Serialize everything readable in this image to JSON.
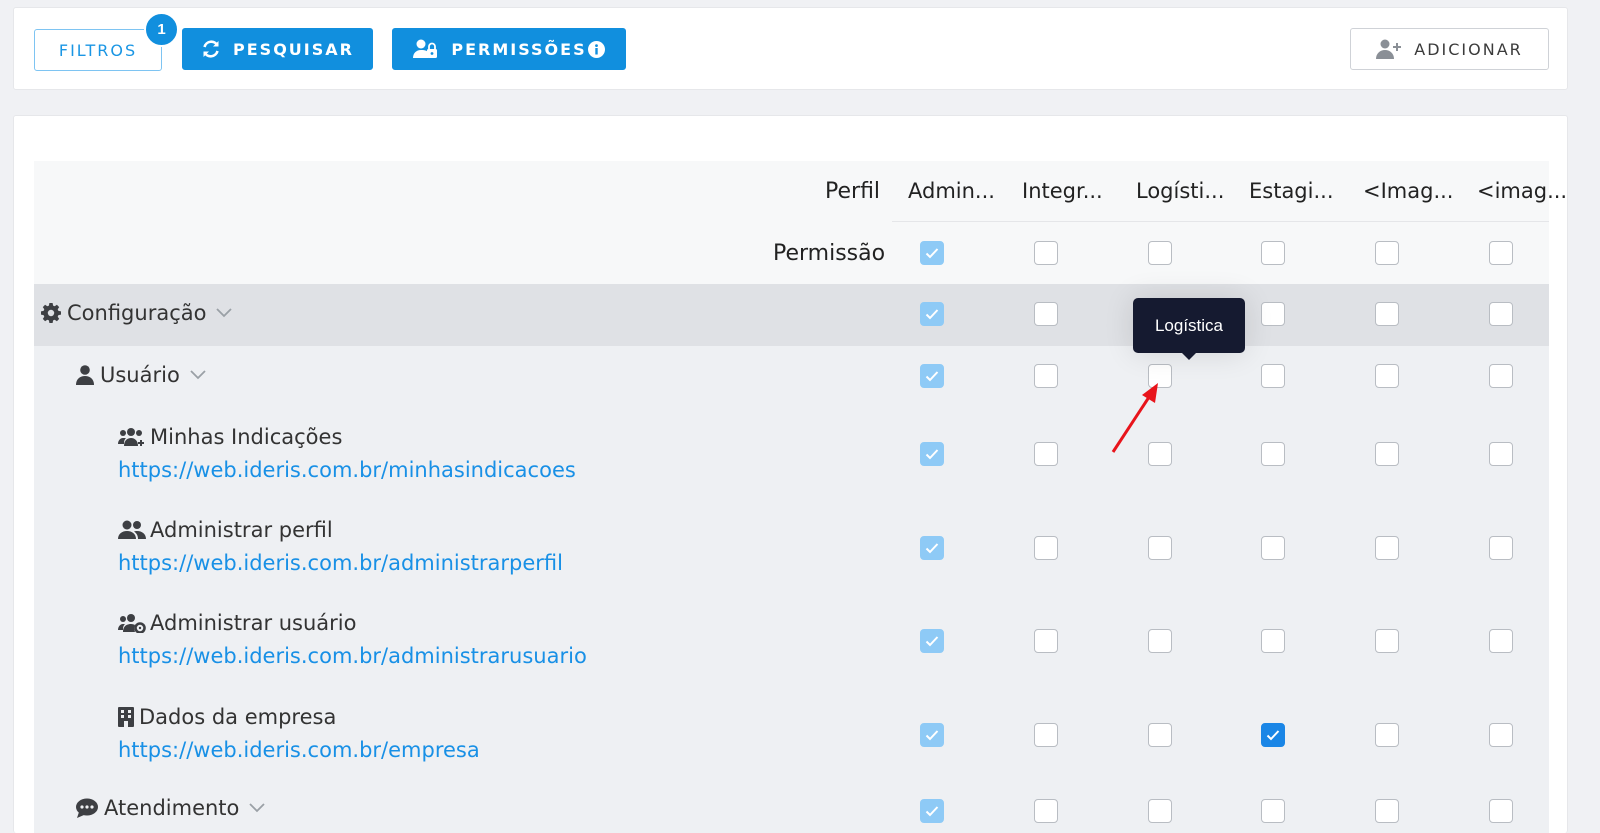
{
  "toolbar": {
    "filtros_label": "FILTROS",
    "filtros_badge": "1",
    "pesquisar_label": "PESQUISAR",
    "permissoes_label": "PERMISSÕES",
    "adicionar_label": "ADICIONAR"
  },
  "table": {
    "perfil_label": "Perfil",
    "permissao_label": "Permissão",
    "columns": [
      "Admin...",
      "Integr...",
      "Logísti...",
      "Estagi...",
      "<Imag...",
      "<imag..."
    ],
    "rows": [
      {
        "label": "Configuração",
        "icon": "gear-icon",
        "checks": [
          true,
          false,
          false,
          false,
          false,
          false
        ]
      },
      {
        "label": "Usuário",
        "icon": "user-icon",
        "checks": [
          true,
          false,
          false,
          false,
          false,
          false
        ]
      },
      {
        "label": "Minhas Indicações",
        "url": "https://web.ideris.com.br/minhasindicacoes",
        "icon": "users-plus-icon",
        "checks": [
          true,
          false,
          false,
          false,
          false,
          false
        ]
      },
      {
        "label": "Administrar perfil",
        "url": "https://web.ideris.com.br/administrarperfil",
        "icon": "users-icon",
        "checks": [
          true,
          false,
          false,
          false,
          false,
          false
        ]
      },
      {
        "label": "Administrar usuário",
        "url": "https://web.ideris.com.br/administrarusuario",
        "icon": "users-cog-icon",
        "checks": [
          true,
          false,
          false,
          false,
          false,
          false
        ]
      },
      {
        "label": "Dados da empresa",
        "url": "https://web.ideris.com.br/empresa",
        "icon": "building-icon",
        "checks": [
          true,
          false,
          false,
          true,
          false,
          false
        ]
      },
      {
        "label": "Atendimento",
        "icon": "comment-icon",
        "checks": [
          true,
          false,
          false,
          false,
          false,
          false
        ]
      }
    ],
    "permissao_checks": [
      true,
      false,
      false,
      false,
      false,
      false
    ]
  },
  "tooltip": {
    "text": "Logística"
  },
  "colors": {
    "primary": "#118fde",
    "link": "#1890e6",
    "tooltip_bg": "#151a30",
    "annotation_arrow": "#e8141b"
  }
}
